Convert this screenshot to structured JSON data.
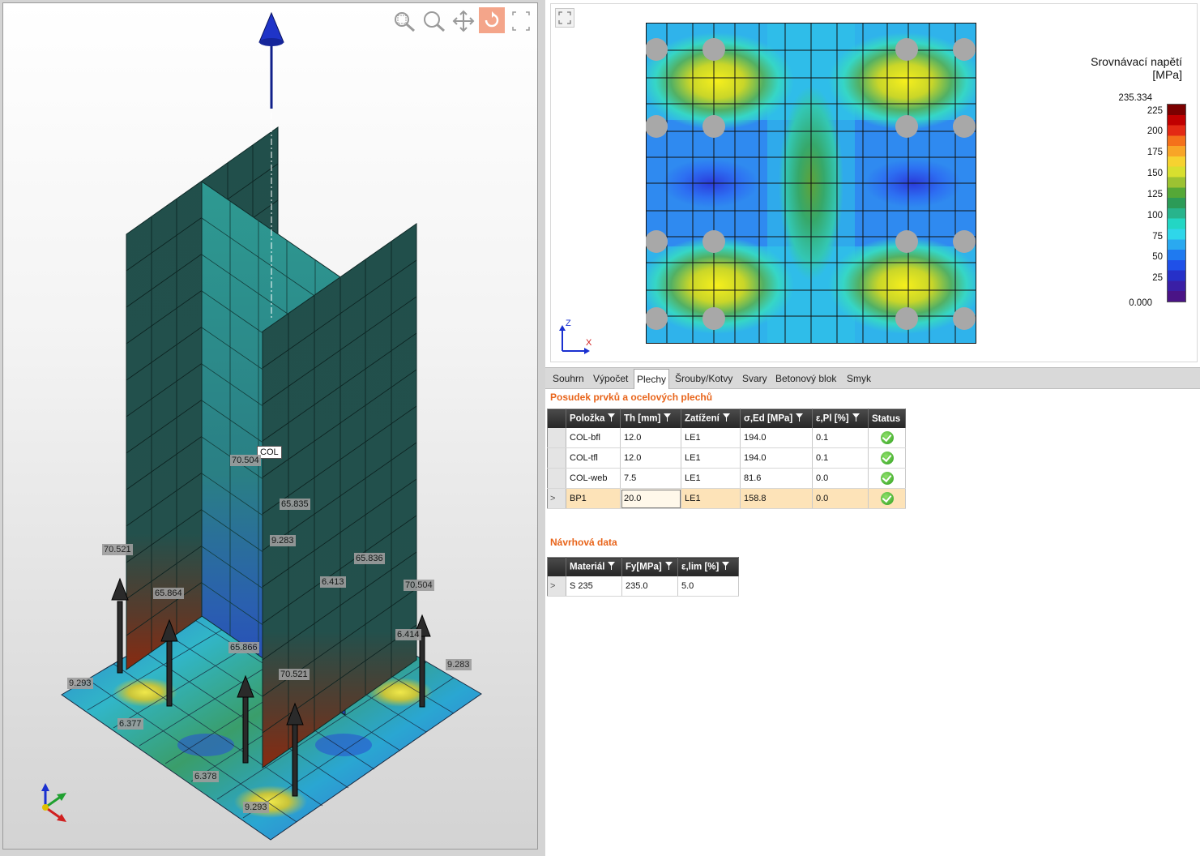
{
  "viewport3d": {
    "member_tag": "COL",
    "value_labels": [
      "70.504",
      "65.835",
      "9.283",
      "65.836",
      "6.413",
      "70.504",
      "70.521",
      "65.864",
      "65.866",
      "70.521",
      "6.414",
      "9.283",
      "9.293",
      "6.377",
      "6.378",
      "9.293"
    ],
    "toolbar_icons": [
      "zoom-window-icon",
      "zoom-icon",
      "pan-icon",
      "rotate-icon",
      "expand-icon"
    ],
    "active_tool": "rotate-icon"
  },
  "plot2d": {
    "legend_title_line1": "Srovnávací napětí",
    "legend_title_line2": "[MPa]",
    "legend_max": "235.334",
    "legend_ticks": [
      "225",
      "200",
      "175",
      "150",
      "125",
      "100",
      "75",
      "50",
      "25"
    ],
    "legend_min": "0.000",
    "legend_colors": [
      "#7b0000",
      "#c00000",
      "#e32a14",
      "#f4711b",
      "#f8a527",
      "#f6d230",
      "#d8df2f",
      "#9cc232",
      "#55a837",
      "#2c9b57",
      "#28b48c",
      "#23d6c4",
      "#2fd6ea",
      "#2aa9f0",
      "#1f7af0",
      "#1f50e8",
      "#2630c8",
      "#3a1fa5",
      "#4a1486"
    ],
    "axis_z": "Z",
    "axis_x": "X",
    "expand_icon": "fullscreen-icon"
  },
  "tabs": [
    "Souhrn",
    "Výpočet",
    "Plechy",
    "Šrouby/Kotvy",
    "Svary",
    "Betonový blok",
    "Smyk"
  ],
  "active_tab": "Plechy",
  "plates_section": {
    "title": "Posudek prvků a ocelových plechů",
    "headers": [
      "Položka",
      "Th [mm]",
      "Zatížení",
      "σ,Ed [MPa]",
      "ε,Pl [%]",
      "Status"
    ],
    "rows": [
      {
        "item": "COL-bfl",
        "th": "12.0",
        "load": "LE1",
        "sigma": "194.0",
        "eps": "0.1",
        "status": "ok"
      },
      {
        "item": "COL-tfl",
        "th": "12.0",
        "load": "LE1",
        "sigma": "194.0",
        "eps": "0.1",
        "status": "ok"
      },
      {
        "item": "COL-web",
        "th": "7.5",
        "load": "LE1",
        "sigma": "81.6",
        "eps": "0.0",
        "status": "ok"
      },
      {
        "item": "BP1",
        "th": "20.0",
        "load": "LE1",
        "sigma": "158.8",
        "eps": "0.0",
        "status": "ok"
      }
    ],
    "selected_row_marker": ">"
  },
  "design_section": {
    "title": "Návrhová data",
    "headers": [
      "Materiál",
      "Fy[MPa]",
      "ε,lim [%]"
    ],
    "rows": [
      {
        "material": "S 235",
        "fy": "235.0",
        "elim": "5.0"
      }
    ],
    "row_marker": ">"
  }
}
